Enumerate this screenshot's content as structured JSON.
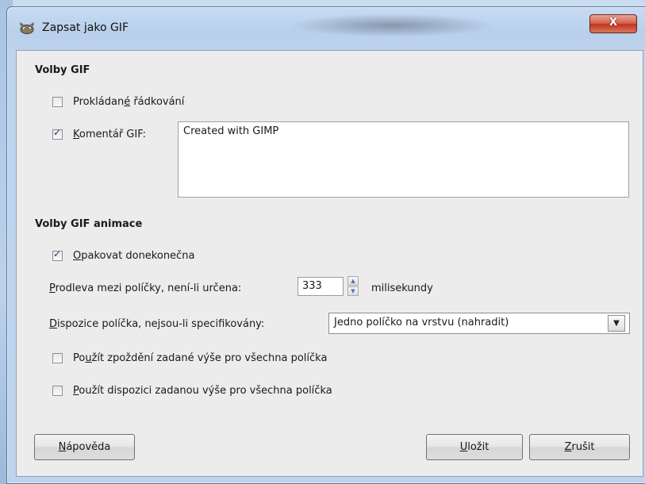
{
  "window": {
    "title": "Zapsat jako GIF",
    "close_label": "X"
  },
  "gif_options": {
    "heading": "Volby GIF",
    "interlace": {
      "label_pre": "Prokládan",
      "label_u": "é",
      "label_post": " řádkování",
      "checked": false
    },
    "comment": {
      "label_u": "K",
      "label_post": "omentář GIF:",
      "checked": true,
      "value": "Created with GIMP"
    }
  },
  "animation_options": {
    "heading": "Volby GIF animace",
    "loop": {
      "label_u": "O",
      "label_post": "pakovat donekonečna",
      "checked": true
    },
    "delay": {
      "label_u": "P",
      "label_post": "rodleva mezi políčky, není-li určena:",
      "value": "333",
      "unit": "milisekundy"
    },
    "disposal": {
      "label_u": "D",
      "label_post": "ispozice políčka, nejsou-li specifikovány:",
      "selected": "Jedno políčko na vrstvu (nahradit)"
    },
    "use_delay": {
      "label_pre": "Po",
      "label_u": "u",
      "label_post": "žít zpoždění zadané výše pro všechna políčka",
      "checked": false
    },
    "use_disposal": {
      "label_u": "P",
      "label_post": "oužít dispozici zadanou výše pro všechna políčka",
      "checked": false
    }
  },
  "buttons": {
    "help": {
      "u": "N",
      "rest": "ápověda"
    },
    "save": {
      "u": "U",
      "rest": "ložit"
    },
    "cancel": {
      "u": "Z",
      "rest": "rušit"
    }
  },
  "colors": {
    "accent_check": "#253a7a",
    "close": "#c0341d",
    "titlebar": "#bed3ec"
  },
  "icons": [
    "gimp-icon",
    "close-icon",
    "spin-up-icon",
    "spin-down-icon",
    "dropdown-arrow-icon"
  ]
}
